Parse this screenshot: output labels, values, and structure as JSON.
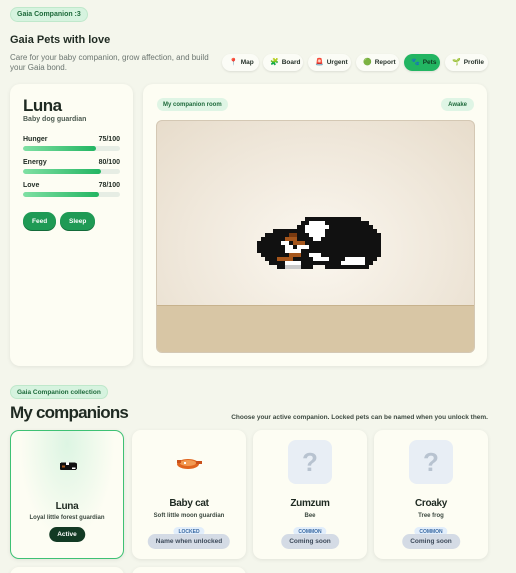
{
  "top_badge": "Gaia Companion :3",
  "header": {
    "title": "Gaia Pets with love",
    "subtitle": "Care for your baby companion, grow affection, and build your Gaia bond."
  },
  "nav": [
    {
      "label": "Map",
      "icon": "map-pin-icon",
      "glyph": "📍",
      "active": false
    },
    {
      "label": "Board",
      "icon": "board-icon",
      "glyph": "🧩",
      "active": false
    },
    {
      "label": "Urgent",
      "icon": "urgent-icon",
      "glyph": "🚨",
      "active": false
    },
    {
      "label": "Report",
      "icon": "report-icon",
      "glyph": "🟢",
      "active": false
    },
    {
      "label": "Pets",
      "icon": "paw-icon",
      "glyph": "🐾",
      "active": true
    },
    {
      "label": "Profile",
      "icon": "profile-icon",
      "glyph": "🌱",
      "active": false
    }
  ],
  "pet": {
    "name": "Luna",
    "subtitle": "Baby dog guardian",
    "stats": [
      {
        "label": "Hunger",
        "value_text": "75/100",
        "value": 75
      },
      {
        "label": "Energy",
        "value_text": "80/100",
        "value": 80
      },
      {
        "label": "Love",
        "value_text": "78/100",
        "value": 78
      }
    ],
    "feed_label": "Feed",
    "sleep_label": "Sleep"
  },
  "room": {
    "label": "My companion room",
    "status": "Awake"
  },
  "collection": {
    "badge": "Gaia Companion collection",
    "title": "My companions",
    "hint": "Choose your active companion. Locked pets can be named when you unlock them.",
    "items": [
      {
        "name": "Luna",
        "desc": "Loyal little forest guardian",
        "button": "Active",
        "tag": ""
      },
      {
        "name": "Baby cat",
        "desc": "Soft little moon guardian",
        "tag": "LOCKED",
        "button": "Name when unlocked"
      },
      {
        "name": "Zumzum",
        "desc": "Bee",
        "tag": "COMMON",
        "button": "Coming soon"
      },
      {
        "name": "Croaky",
        "desc": "Tree frog",
        "tag": "COMMON",
        "button": "Coming soon"
      }
    ]
  },
  "colors": {
    "accent": "#22b562",
    "background": "#f4f6ec",
    "card": "#fdfdf3"
  }
}
